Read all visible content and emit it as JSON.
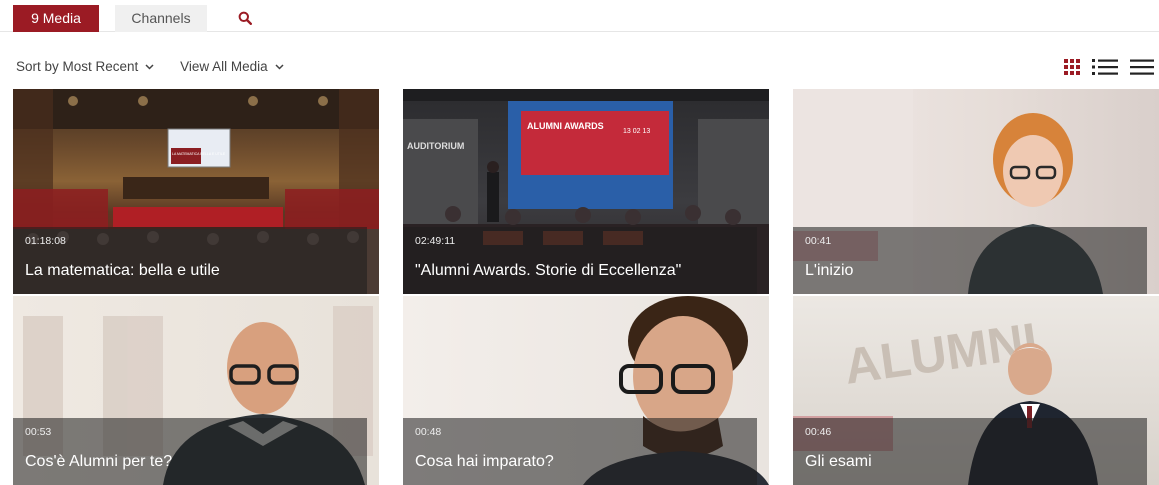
{
  "tabs": {
    "media_label": "9 Media",
    "channels_label": "Channels",
    "search_icon": "search-icon"
  },
  "toolbar": {
    "sort_label": "Sort by Most Recent",
    "filter_label": "View All Media",
    "view_modes": [
      "grid-view-icon",
      "list-view-icon",
      "compact-list-icon"
    ],
    "active_view": "grid-view-icon"
  },
  "colors": {
    "accent": "#9b1b24",
    "tab_inactive_bg": "#f0f0f0"
  },
  "media": [
    {
      "duration": "01:18:08",
      "title": "La matematica: bella e utile"
    },
    {
      "duration": "02:49:11",
      "title": "\"Alumni Awards. Storie di Eccellenza\""
    },
    {
      "duration": "00:41",
      "title": "L'inizio"
    },
    {
      "duration": "00:53",
      "title": "Cos'è Alumni per te?"
    },
    {
      "duration": "00:48",
      "title": "Cosa hai imparato?"
    },
    {
      "duration": "00:46",
      "title": "Gli esami"
    }
  ],
  "thumbnail_text": {
    "slide_1": "LA MATEMATICA BELLA E UTILE",
    "slide_2_title": "ALUMNI AWARDS",
    "slide_2_date": "13 02 13",
    "wall_2": "AUDITORIUM",
    "wall_6": "ALUMNI"
  }
}
